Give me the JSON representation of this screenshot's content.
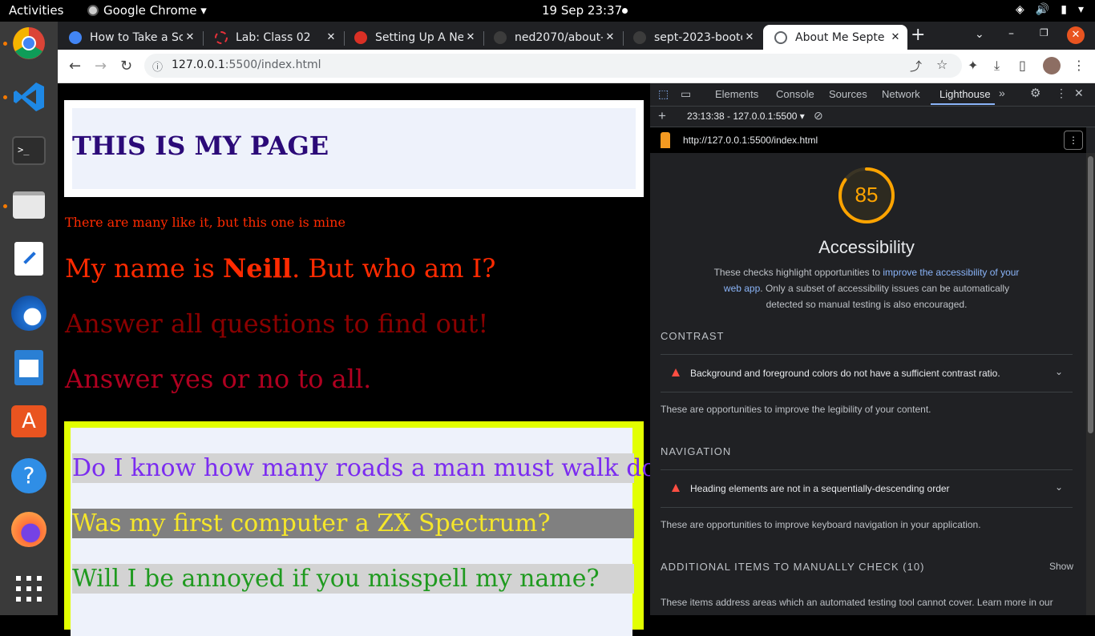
{
  "system": {
    "activities": "Activities",
    "app_menu": "Google Chrome ▾",
    "clock": "19 Sep  23:37"
  },
  "browser": {
    "tabs": [
      {
        "title": "How to Take a Sc",
        "favicon_color": "#4285f4"
      },
      {
        "title": "Lab: Class 02",
        "favicon_color": "#e8313a"
      },
      {
        "title": "Setting Up A New",
        "favicon_color": "#d93025"
      },
      {
        "title": "ned2070/about-",
        "favicon_color": "#3c3c3c"
      },
      {
        "title": "sept-2023-bootc",
        "favicon_color": "#3c3c3c"
      },
      {
        "title": "About Me Septe",
        "favicon_color": "#5f6368"
      }
    ],
    "url_host": "127.0.0.1",
    "url_rest": ":5500/index.html"
  },
  "page": {
    "heading": "THIS IS MY PAGE",
    "tagline": "There are many like it, but this one is mine",
    "intro_before": "My name is ",
    "intro_name": "Neill",
    "intro_after": ". But who am I?",
    "instruction1": "Answer all questions to find out!",
    "instruction2": "Answer yes or no to all.",
    "questions": [
      {
        "text": "Do I know how many roads a man must walk down?",
        "color": "#7b2cf0",
        "bg": "#d3d3d3"
      },
      {
        "text": "Was my first computer a ZX Spectrum?",
        "color": "#f5e62a",
        "bg": "#808080"
      },
      {
        "text": "Will I be annoyed if you misspell my name?",
        "color": "#1f9a1f",
        "bg": "#d3d3d3"
      }
    ]
  },
  "devtools": {
    "tabs": [
      "Elements",
      "Console",
      "Sources",
      "Network",
      "Lighthouse"
    ],
    "active_tab": "Lighthouse",
    "report_label": "23:13:38 - 127.0.0.1:5500",
    "report_url": "http://127.0.0.1:5500/index.html",
    "score": 85,
    "score_color": "#ffa400",
    "category": "Accessibility",
    "desc_before": "These checks highlight opportunities to ",
    "desc_link": "improve the accessibility of your web app",
    "desc_after": ". Only a subset of accessibility issues can be automatically detected so manual testing is also encouraged.",
    "sections": {
      "contrast": {
        "title": "CONTRAST",
        "audit": "Background and foreground colors do not have a sufficient contrast ratio.",
        "note": "These are opportunities to improve the legibility of your content."
      },
      "navigation": {
        "title": "NAVIGATION",
        "audit": "Heading elements are not in a sequentially-descending order",
        "note": "These are opportunities to improve keyboard navigation in your application."
      },
      "manual": {
        "title": "ADDITIONAL ITEMS TO MANUALLY CHECK (10)",
        "show": "Show",
        "note": "These items address areas which an automated testing tool cannot cover. Learn more in our"
      }
    }
  }
}
